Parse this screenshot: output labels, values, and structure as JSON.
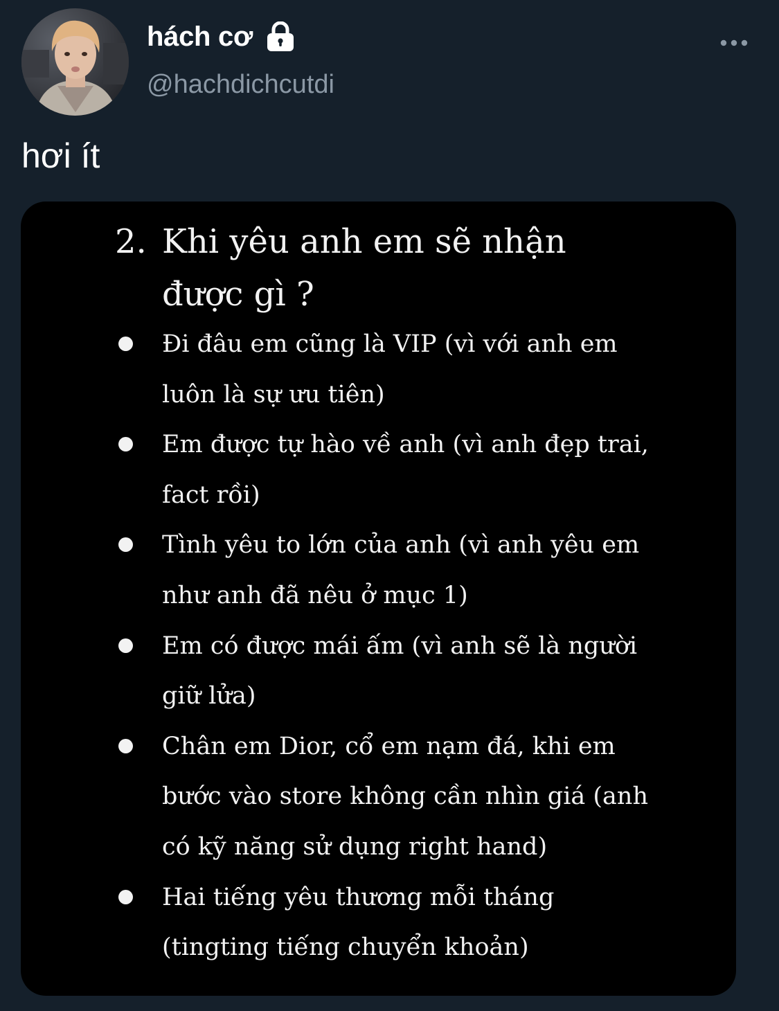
{
  "tweet": {
    "display_name": "hách cơ",
    "handle": "@hachdichcutdi",
    "text": "hơi ít"
  },
  "icons": {
    "lock": "lock-icon",
    "more": "more-icon",
    "avatar": "avatar-photo"
  },
  "colors": {
    "background": "#15202b",
    "secondary_text": "#8b98a5",
    "media_background": "#000000"
  },
  "media": {
    "heading_number": "2.",
    "heading_lines": [
      "Khi yêu anh em sẽ nhận",
      "được gì ?"
    ],
    "bullets": [
      [
        "Đi đâu em cũng là VIP (vì với anh em",
        "luôn là sự ưu tiên)"
      ],
      [
        "Em được tự hào về anh (vì anh đẹp trai,",
        "fact rồi)"
      ],
      [
        "Tình yêu to lớn của anh (vì anh yêu em",
        "như anh đã nêu ở mục 1)"
      ],
      [
        "Em có được mái ấm (vì anh sẽ là người",
        "giữ lửa)"
      ],
      [
        "Chân em Dior, cổ em nạm đá, khi em",
        "bước vào store không cần nhìn giá (anh",
        "có kỹ năng sử dụng right hand)"
      ],
      [
        "Hai tiếng yêu thương mỗi tháng",
        "(tingting tiếng chuyển khoản)"
      ]
    ]
  }
}
